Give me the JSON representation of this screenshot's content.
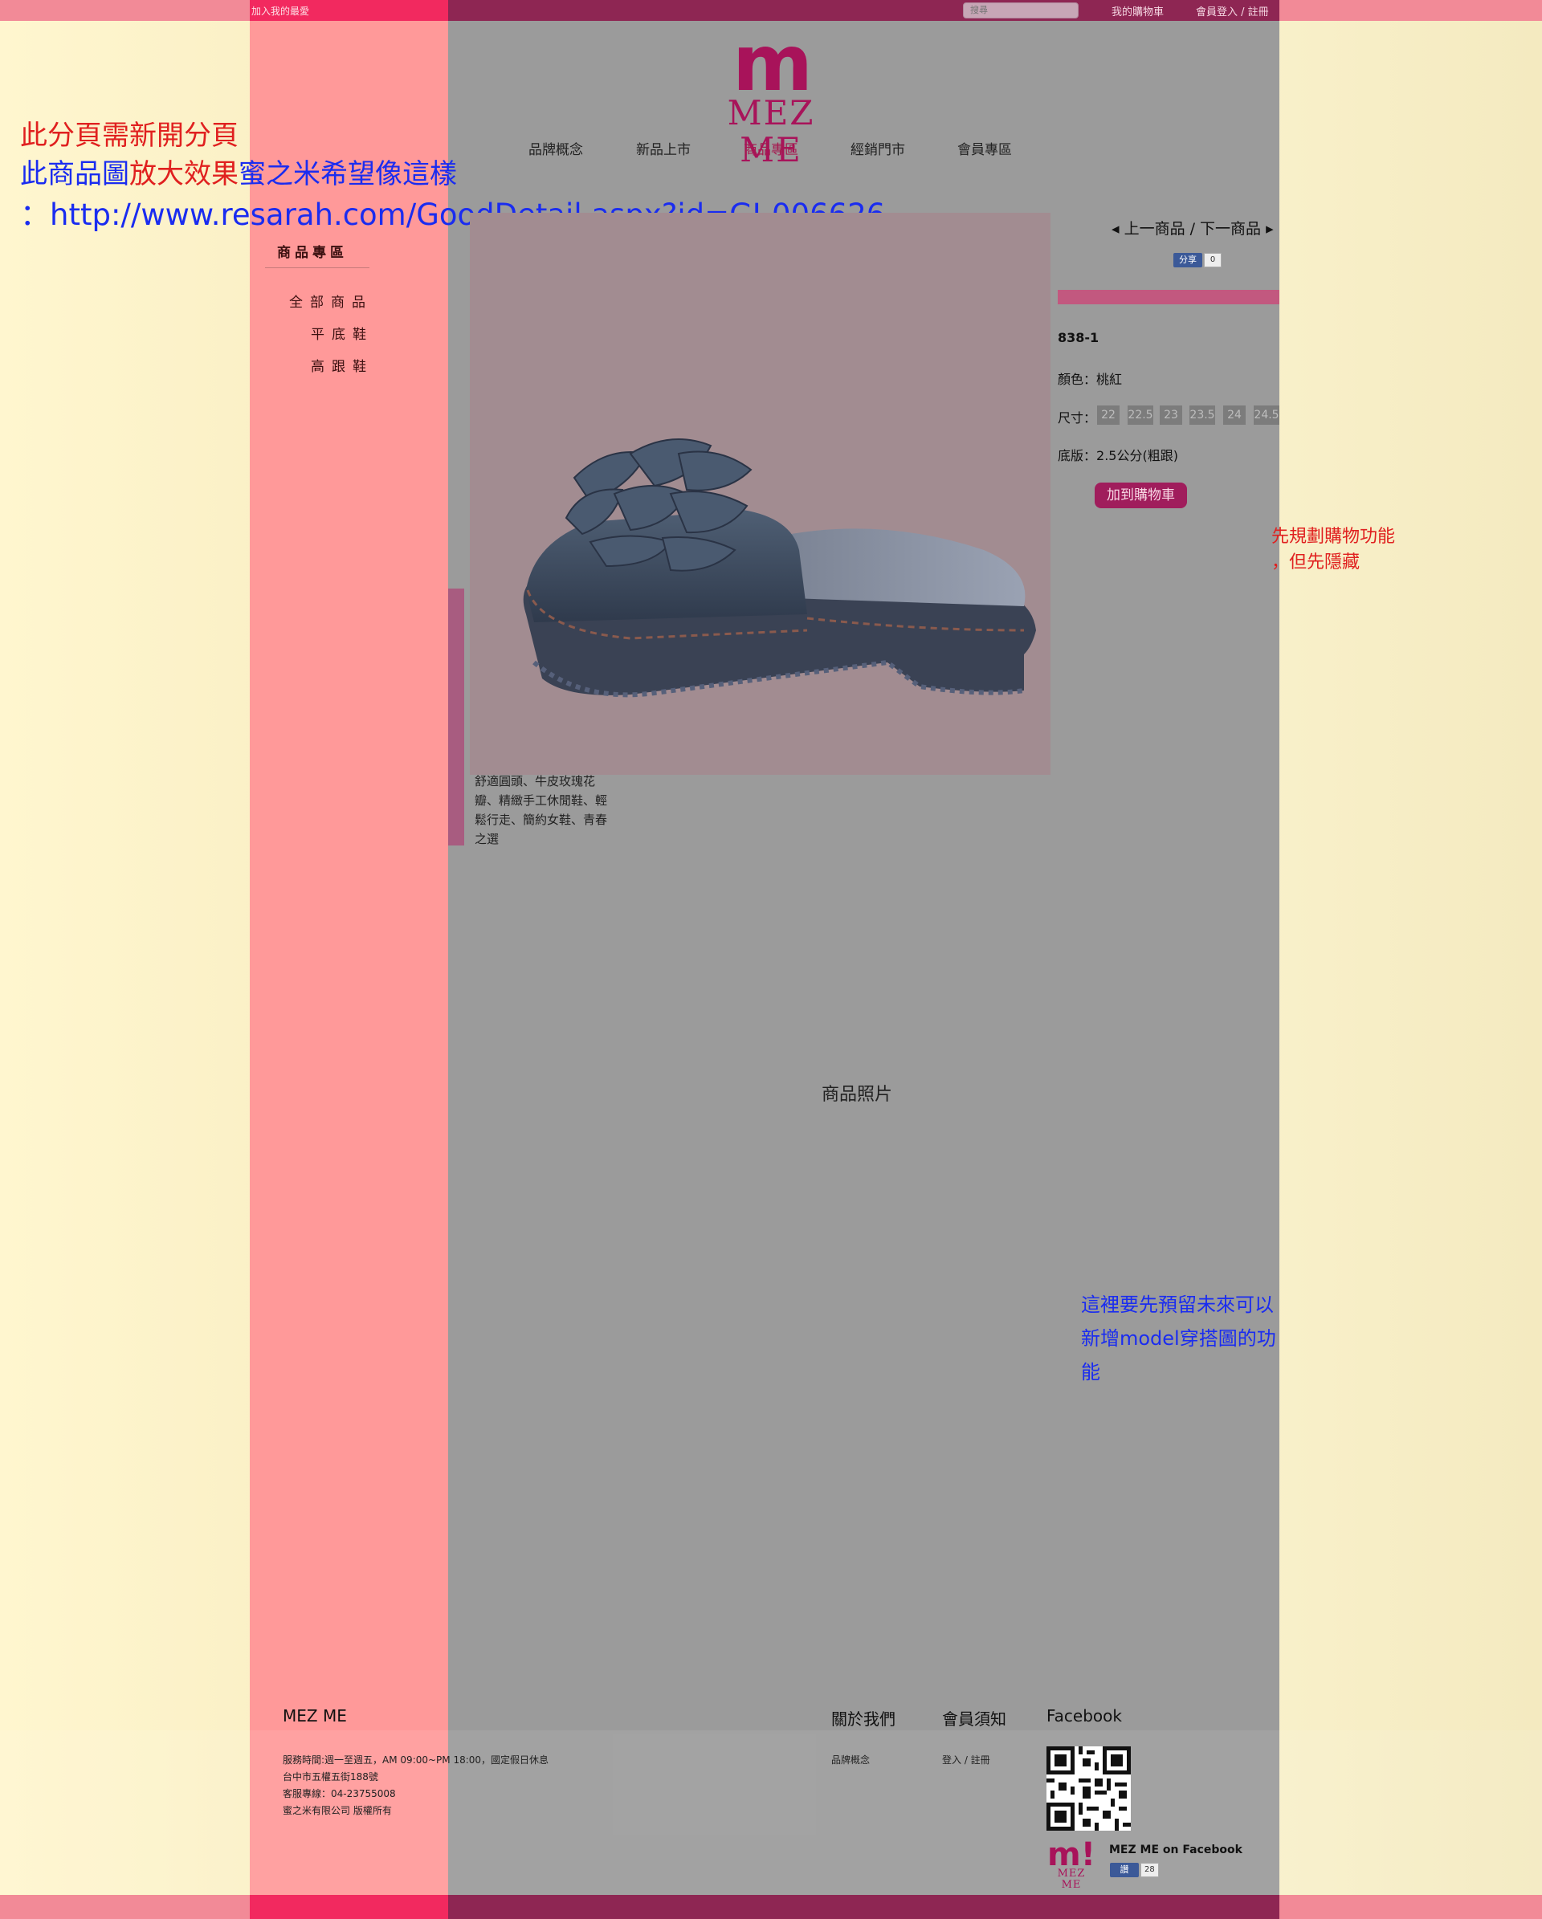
{
  "topbar": {
    "join_favorite": "加入我的最愛",
    "search_placeholder": "搜尋",
    "my_cart": "我的購物車",
    "login_register": "會員登入 / 註冊"
  },
  "logo": {
    "mark": "m",
    "wordmark": "MEZ ME"
  },
  "nav": {
    "items": [
      {
        "label": "品牌概念"
      },
      {
        "label": "新品上市"
      },
      {
        "label": "商品專區",
        "active": true
      },
      {
        "label": "經銷門市"
      },
      {
        "label": "會員專區"
      }
    ]
  },
  "annotations": {
    "line1": "此分頁需新開分頁",
    "line2_part1": "此商品圖",
    "line2_part2": "放大效果",
    "line2_part3": "蜜之米希望像這樣",
    "line3": "：http://www.resarah.com/GoodDetail.aspx?id=GI-006626",
    "cart_note_1": "先規劃購物功能",
    "cart_note_2": "，但先隱藏",
    "model_note_1": "這裡要先預留未來可以",
    "model_note_2": "新增model穿搭圖的功",
    "model_note_3": "能"
  },
  "sidebar": {
    "title": "商品專區",
    "items": [
      {
        "label": "全部商品"
      },
      {
        "label": "平底鞋"
      },
      {
        "label": "高跟鞋"
      }
    ]
  },
  "product": {
    "description": "舒適圓頭、牛皮玫瑰花瓣、精緻手工休閒鞋、輕鬆行走、簡約女鞋、青春之選",
    "prev_next": "上一商品 / 下一商品",
    "fb_share_label": "分享",
    "fb_share_count": "0",
    "code": "838-1",
    "color_label": "顏色：",
    "color_value": "桃紅",
    "size_label": "尺寸：",
    "sizes": [
      "22",
      "22.5",
      "23",
      "23.5",
      "24",
      "24.5"
    ],
    "sole_label": "底版：",
    "sole_value": "2.5公分(粗跟)",
    "add_to_cart": "加到購物車",
    "photo_label": "商品照片"
  },
  "footer": {
    "brand": "MEZ ME",
    "hours": "服務時間:週一至週五，AM 09:00~PM 18:00，國定假日休息",
    "address": "台中市五權五街188號",
    "phone": "客服專線：04-23755008",
    "copyright": "蜜之米有限公司 版權所有",
    "about_title": "關於我們",
    "about_link": "品牌概念",
    "member_title": "會員須知",
    "member_link": "登入 / 註冊",
    "facebook_title": "Facebook",
    "fb_page_name": "MEZ ME on Facebook",
    "fb_logo_mark": "m!",
    "fb_logo_word": "MEZ ME",
    "fb_like_label": "讚",
    "fb_like_count": "28"
  }
}
